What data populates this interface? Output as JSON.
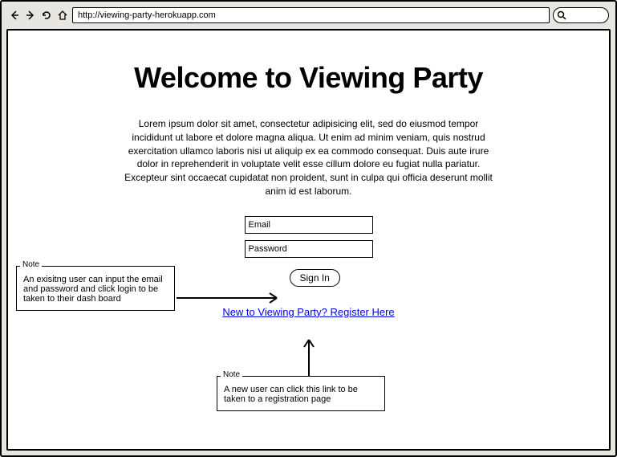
{
  "browser": {
    "url": "http://viewing-party-herokuapp.com"
  },
  "page": {
    "title": "Welcome to Viewing Party",
    "description": "Lorem ipsum dolor sit amet, consectetur adipisicing elit, sed do eiusmod tempor incididunt ut labore et dolore magna aliqua. Ut enim ad minim veniam, quis nostrud exercitation ullamco laboris nisi ut aliquip ex ea commodo consequat. Duis aute irure dolor in reprehenderit in voluptate velit esse cillum dolore eu fugiat nulla pariatur. Excepteur sint occaecat cupidatat non proident, sunt in culpa qui officia deserunt mollit anim id est laborum."
  },
  "form": {
    "email_placeholder": "Email",
    "password_placeholder": "Password",
    "signin_label": "Sign In"
  },
  "register_link": "New to Viewing Party? Register Here",
  "notes": {
    "label": "Note",
    "note1": "An exisitng user can input the email and password and click login to be taken to their dash board",
    "note2": "A new user can click this link to be taken to a registration page"
  }
}
